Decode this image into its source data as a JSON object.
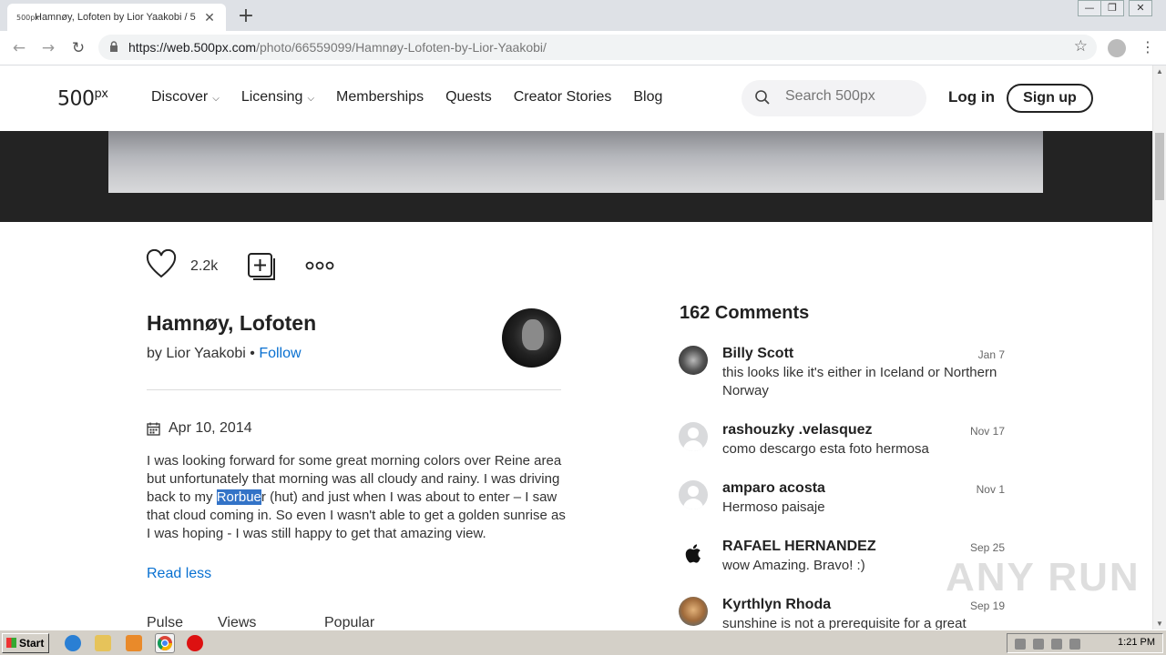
{
  "browser": {
    "tab_favicon": "500px",
    "tab_title": "Hamnøy, Lofoten by Lior Yaakobi / 5",
    "tab_close": "✕",
    "new_tab": "+",
    "url_host": "https://web.500px.com",
    "url_path": "/photo/66559099/Hamnøy-Lofoten-by-Lior-Yaakobi/",
    "back": "←",
    "forward": "→",
    "reload": "↻",
    "star": "☆",
    "menu": "⋮",
    "win_minimize": "—",
    "win_restore": "❐",
    "win_close": "✕"
  },
  "header": {
    "logo": "500",
    "logo_sup": "px",
    "nav": [
      {
        "label": "Discover",
        "chevron": "⌵"
      },
      {
        "label": "Licensing",
        "chevron": "⌵"
      },
      {
        "label": "Memberships",
        "chevron": ""
      },
      {
        "label": "Quests",
        "chevron": ""
      },
      {
        "label": "Creator Stories",
        "chevron": ""
      },
      {
        "label": "Blog",
        "chevron": ""
      }
    ],
    "search_placeholder": "Search 500px",
    "login": "Log in",
    "signup": "Sign up"
  },
  "photo": {
    "like_count": "2.2k",
    "title": "Hamnøy, Lofoten",
    "by_prefix": "by ",
    "author": "Lior Yaakobi",
    "separator": " • ",
    "follow": "Follow",
    "date": "Apr 10, 2014",
    "desc_before": "I was looking forward for some great morning colors over Reine area but unfortunately that morning was all cloudy and rainy. I was driving back to my ",
    "desc_highlight": "Rorbue",
    "desc_after": "r (hut) and just when I was about to enter – I saw that cloud coming in. So even I wasn't able to get a golden sunrise as I was hoping -  I was still happy to get that amazing view.",
    "read_less": "Read less",
    "stats": [
      "Pulse",
      "Views",
      "Popular"
    ]
  },
  "comments": {
    "title": "162 Comments",
    "items": [
      {
        "name": "Billy Scott",
        "date": "Jan 7",
        "text": "this looks like it's either in Iceland or Northern Norway"
      },
      {
        "name": "rashouzky .velasquez",
        "date": "Nov 17",
        "text": "como descargo esta foto hermosa"
      },
      {
        "name": "amparo acosta",
        "date": "Nov 1",
        "text": "Hermoso paisaje"
      },
      {
        "name": "RAFAEL HERNANDEZ",
        "date": "Sep 25",
        "text": "wow Amazing. Bravo! :)"
      },
      {
        "name": "Kyrthlyn Rhoda",
        "date": "Sep 19",
        "text": "sunshine is not a prerequisite for a great"
      }
    ]
  },
  "watermark": "ANY RUN",
  "taskbar": {
    "start": "Start",
    "clock": "1:21 PM"
  }
}
